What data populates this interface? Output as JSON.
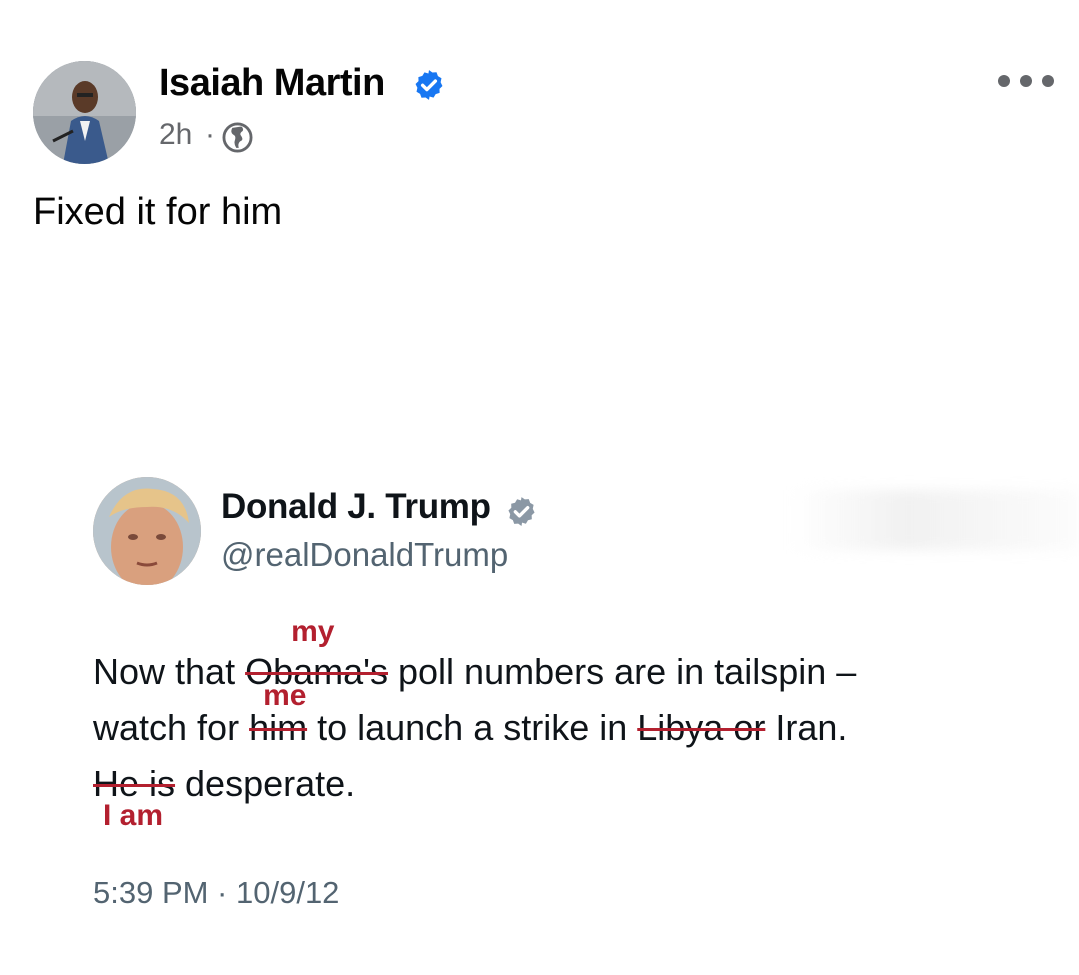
{
  "post": {
    "author_name": "Isaiah Martin",
    "timestamp": "2h",
    "separator": "·",
    "audience_icon": "globe-icon",
    "verified_icon": "verified-badge-icon",
    "more_icon": "more-options-icon",
    "text": "Fixed it for him"
  },
  "tweet": {
    "author_name": "Donald J. Trump",
    "handle": "@realDonaldTrump",
    "verified_icon": "verified-badge-icon",
    "line1": {
      "before": "Now that ",
      "struck": "Obama's",
      "correction": "my",
      "after": " poll numbers are in tailspin –"
    },
    "line2": {
      "before": "watch for ",
      "struck": "him",
      "correction": "me",
      "middle": " to launch a strike in ",
      "struck2": "Libya or",
      "after": " Iran."
    },
    "line3": {
      "struck": "He is",
      "correction": "I am",
      "after": " desperate."
    },
    "timestamp": "5:39 PM · 10/9/12"
  },
  "colors": {
    "fb_blue": "#1877f2",
    "edit_red": "#b3202f",
    "meta_gray": "#65676b"
  }
}
